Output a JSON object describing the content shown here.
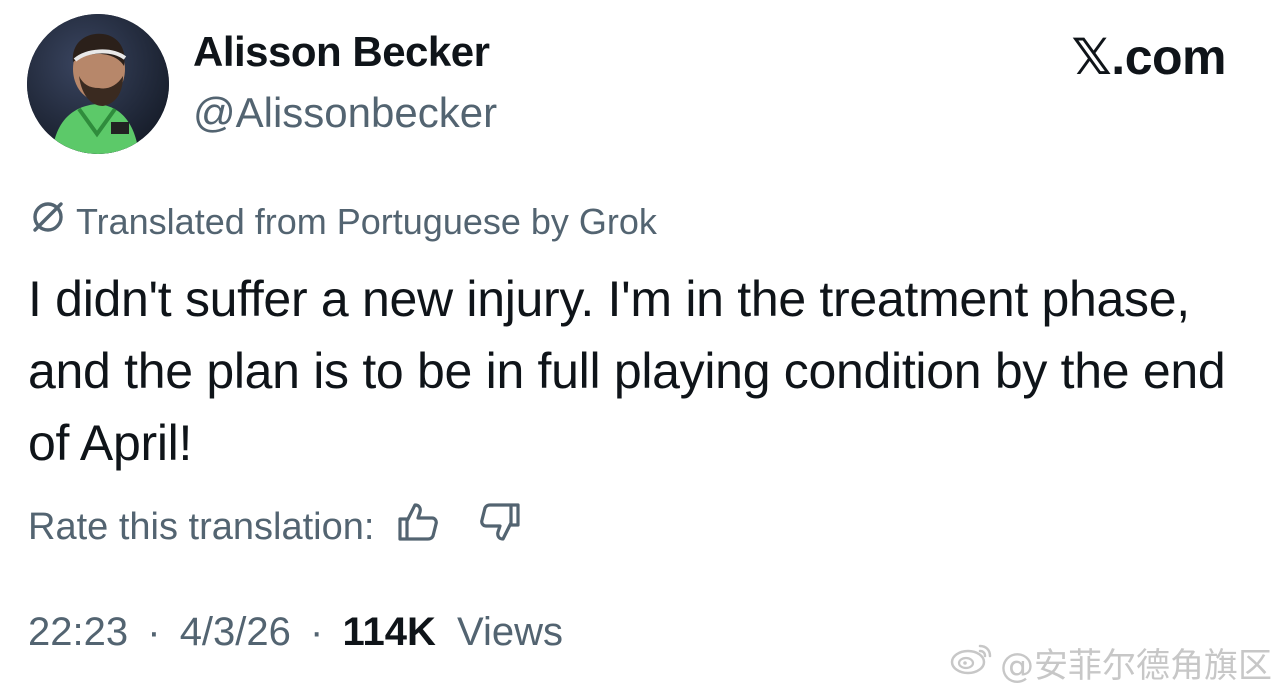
{
  "author": {
    "name": "Alisson Becker",
    "handle": "@Alissonbecker"
  },
  "site": {
    "brand": "𝕏.com"
  },
  "translation": {
    "note": "Translated from Portuguese by Grok",
    "icon": "grok-slash-icon"
  },
  "tweet": {
    "text": "I didn't suffer a new injury. I'm in the treatment phase, and the plan is to be in full playing condition by the end of April!"
  },
  "rating": {
    "label": "Rate this translation:",
    "thumbs_up_icon": "thumbs-up-icon",
    "thumbs_down_icon": "thumbs-down-icon"
  },
  "meta": {
    "time": "22:23",
    "separator": "·",
    "date": "4/3/26",
    "views_count": "114K",
    "views_label": "Views"
  },
  "watermark": {
    "text": "@安菲尔德角旗区",
    "icon": "weibo-icon"
  },
  "colors": {
    "text_primary": "#0f1419",
    "text_secondary": "#536471",
    "background": "#ffffff"
  }
}
